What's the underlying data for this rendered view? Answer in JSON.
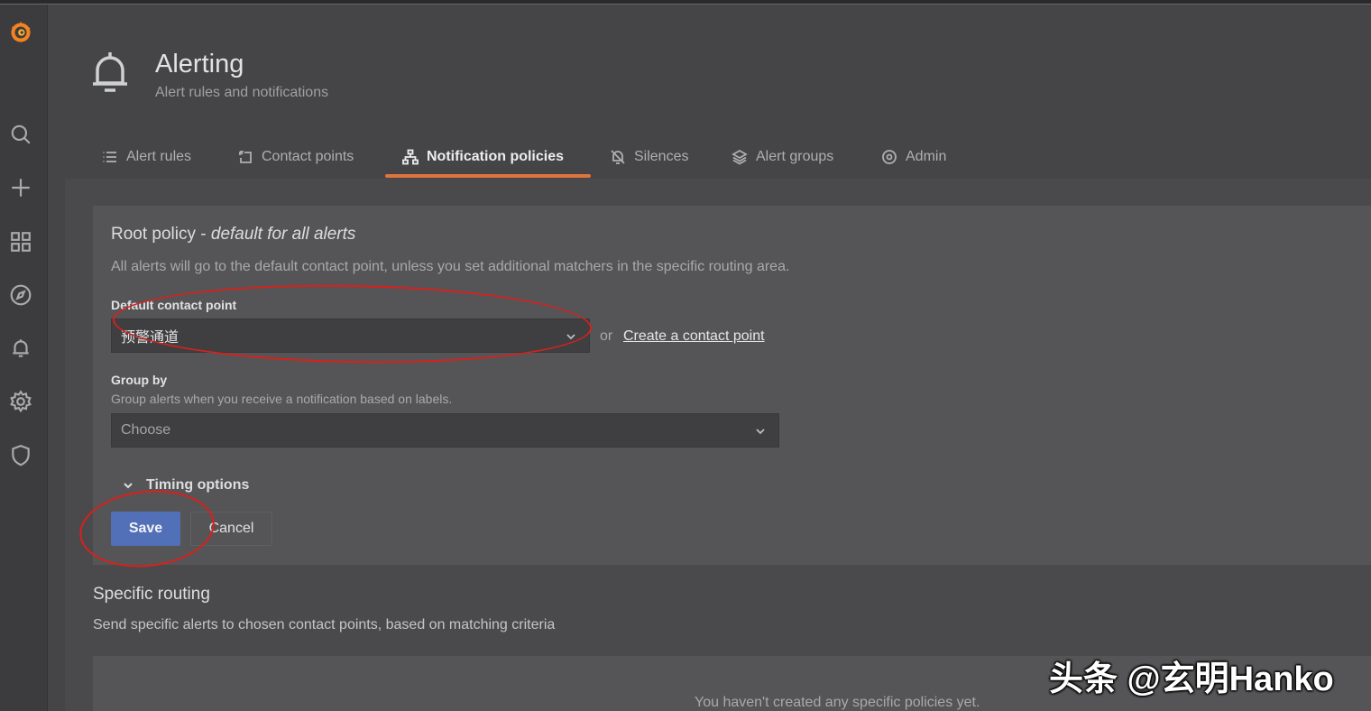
{
  "header": {
    "title": "Alerting",
    "subtitle": "Alert rules and notifications"
  },
  "tabs": [
    {
      "label": "Alert rules",
      "icon": "list-icon"
    },
    {
      "label": "Contact points",
      "icon": "contact-icon"
    },
    {
      "label": "Notification policies",
      "icon": "sitemap-icon",
      "active": true
    },
    {
      "label": "Silences",
      "icon": "bell-slash-icon"
    },
    {
      "label": "Alert groups",
      "icon": "layers-icon"
    },
    {
      "label": "Admin",
      "icon": "cog-icon"
    }
  ],
  "root_policy": {
    "title": "Root policy - ",
    "title_italic": "default for all alerts",
    "description": "All alerts will go to the default contact point, unless you set additional matchers in the specific routing area.",
    "default_contact_label": "Default contact point",
    "default_contact_value": "预警通道",
    "or_text": "or",
    "create_link": "Create a contact point",
    "group_by_label": "Group by",
    "group_by_desc": "Group alerts when you receive a notification based on labels.",
    "group_by_placeholder": "Choose",
    "timing_label": "Timing options",
    "save_label": "Save",
    "cancel_label": "Cancel"
  },
  "specific_routing": {
    "title": "Specific routing",
    "description": "Send specific alerts to chosen contact points, based on matching criteria",
    "empty_text": "You haven't created any specific policies yet."
  },
  "watermark": "头条 @玄明Hanko",
  "colors": {
    "accent_tab": "#e0743e",
    "primary_button": "#5270b8",
    "annotation": "#d9201c"
  }
}
